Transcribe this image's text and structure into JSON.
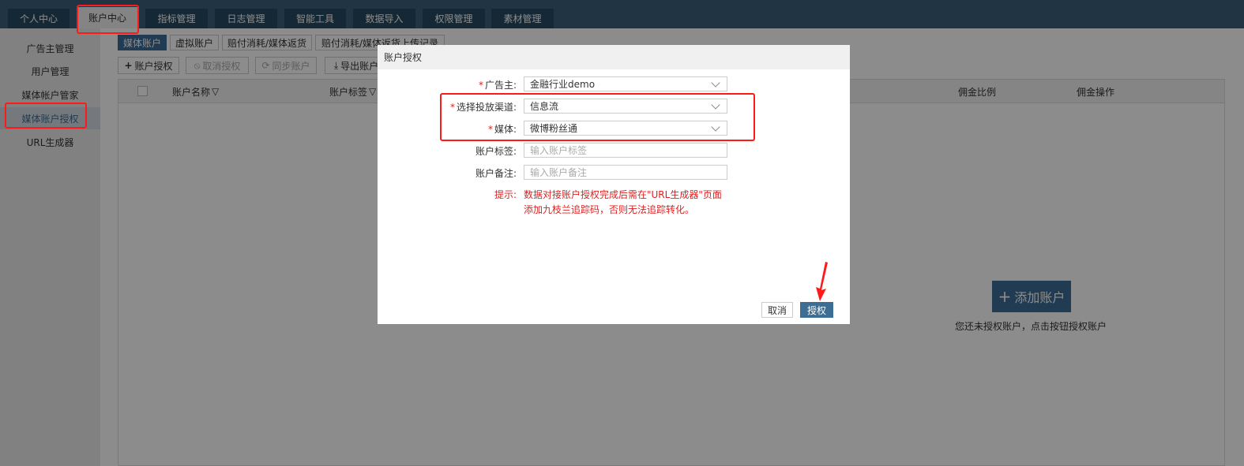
{
  "top_nav": {
    "tabs": [
      {
        "label": "个人中心"
      },
      {
        "label": "账户中心"
      },
      {
        "label": "指标管理"
      },
      {
        "label": "日志管理"
      },
      {
        "label": "智能工具"
      },
      {
        "label": "数据导入"
      },
      {
        "label": "权限管理"
      },
      {
        "label": "素材管理"
      }
    ],
    "active_index": 1
  },
  "sidebar": {
    "items": [
      {
        "label": "广告主管理"
      },
      {
        "label": "用户管理"
      },
      {
        "label": "媒体帐户管家"
      },
      {
        "label": "媒体账户授权"
      },
      {
        "label": "URL生成器"
      }
    ],
    "active_index": 3
  },
  "subtabs": [
    {
      "label": "媒体账户"
    },
    {
      "label": "虚拟账户"
    },
    {
      "label": "赔付消耗/媒体返货"
    },
    {
      "label": "赔付消耗/媒体返货上传记录"
    }
  ],
  "toolbar": {
    "authorize": "账户授权",
    "cancel_authorize": "取消授权",
    "sync": "同步账户",
    "export": "导出账户"
  },
  "grid": {
    "columns": [
      "账户名称",
      "账户标签",
      "佣金比例",
      "佣金操作"
    ]
  },
  "empty_state": {
    "add_button": "添加账户",
    "hint": "您还未授权账户，点击按钮授权账户"
  },
  "modal": {
    "title": "账户授权",
    "fields": {
      "advertiser": {
        "label": "广告主:",
        "value": "金融行业demo"
      },
      "channel": {
        "label": "选择投放渠道:",
        "value": "信息流"
      },
      "media": {
        "label": "媒体:",
        "value": "微博粉丝通"
      },
      "tag": {
        "label": "账户标签:",
        "placeholder": "输入账户标签"
      },
      "note": {
        "label": "账户备注:",
        "placeholder": "输入账户备注"
      }
    },
    "tip_label": "提示:",
    "tip_text": "数据对接账户授权完成后需在\"URL生成器\"页面添加九枝兰追踪码，否则无法追踪转化。",
    "cancel": "取消",
    "confirm": "授权"
  },
  "colors": {
    "nav_bg": "#3c5f7a",
    "nav_tab": "#274a63",
    "accent": "#3c6e95",
    "annotation_red": "#ff1a1a",
    "tip_red": "#e02020"
  }
}
